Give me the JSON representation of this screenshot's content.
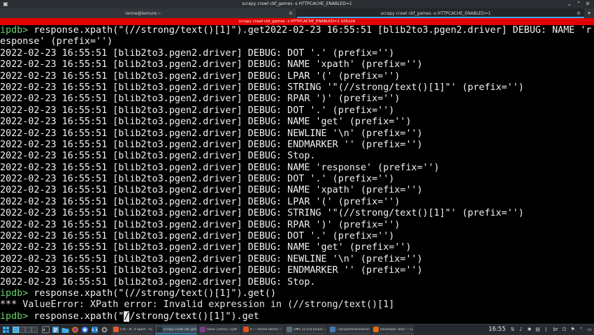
{
  "window": {
    "title": "scrapy crawl cbf_games -s HTTPCACHE_ENABLED=1",
    "status": "scrapy crawl cbf_games -s HTTPCACHE_ENABLED=1 105x26"
  },
  "tabs": [
    {
      "label": "renne@lemure:~"
    },
    {
      "label": "scrapy crawl cbf_games -s HTTPCACHE_ENABLED=1"
    }
  ],
  "terminal": {
    "prompt": "ipdb>",
    "lines": [
      "ipdb> response.xpath(\"(//strong/text()[1]\").get2022-02-23 16:55:51 [blib2to3.pgen2.driver] DEBUG: NAME 'r",
      "esponse' (prefix='')",
      "2022-02-23 16:55:51 [blib2to3.pgen2.driver] DEBUG: DOT '.' (prefix='')",
      "2022-02-23 16:55:51 [blib2to3.pgen2.driver] DEBUG: NAME 'xpath' (prefix='')",
      "2022-02-23 16:55:51 [blib2to3.pgen2.driver] DEBUG: LPAR '(' (prefix='')",
      "2022-02-23 16:55:51 [blib2to3.pgen2.driver] DEBUG: STRING '\"(//strong/text()[1]\"' (prefix='')",
      "2022-02-23 16:55:51 [blib2to3.pgen2.driver] DEBUG: RPAR ')' (prefix='')",
      "2022-02-23 16:55:51 [blib2to3.pgen2.driver] DEBUG: DOT '.' (prefix='')",
      "2022-02-23 16:55:51 [blib2to3.pgen2.driver] DEBUG: NAME 'get' (prefix='')",
      "2022-02-23 16:55:51 [blib2to3.pgen2.driver] DEBUG: NEWLINE '\\n' (prefix='')",
      "2022-02-23 16:55:51 [blib2to3.pgen2.driver] DEBUG: ENDMARKER '' (prefix='')",
      "2022-02-23 16:55:51 [blib2to3.pgen2.driver] DEBUG: Stop.",
      "2022-02-23 16:55:51 [blib2to3.pgen2.driver] DEBUG: NAME 'response' (prefix='')",
      "2022-02-23 16:55:51 [blib2to3.pgen2.driver] DEBUG: DOT '.' (prefix='')",
      "2022-02-23 16:55:51 [blib2to3.pgen2.driver] DEBUG: NAME 'xpath' (prefix='')",
      "2022-02-23 16:55:51 [blib2to3.pgen2.driver] DEBUG: LPAR '(' (prefix='')",
      "2022-02-23 16:55:51 [blib2to3.pgen2.driver] DEBUG: STRING '\"(//strong/text()[1]\"' (prefix='')",
      "2022-02-23 16:55:51 [blib2to3.pgen2.driver] DEBUG: RPAR ')' (prefix='')",
      "2022-02-23 16:55:51 [blib2to3.pgen2.driver] DEBUG: DOT '.' (prefix='')",
      "2022-02-23 16:55:51 [blib2to3.pgen2.driver] DEBUG: NAME 'get' (prefix='')",
      "2022-02-23 16:55:51 [blib2to3.pgen2.driver] DEBUG: NEWLINE '\\n' (prefix='')",
      "2022-02-23 16:55:51 [blib2to3.pgen2.driver] DEBUG: ENDMARKER '' (prefix='')",
      "2022-02-23 16:55:51 [blib2to3.pgen2.driver] DEBUG: Stop.",
      "ipdb> response.xpath(\"(//strong/text()[1]\").get()",
      "*** ValueError: XPath error: Invalid expression in (//strong/text()[1]"
    ],
    "input_before_cursor": " response.xpath(\"",
    "input_cursor_char": "/",
    "input_after_cursor": "/strong/text()[1]\").get"
  },
  "taskbar": {
    "tasks": [
      {
        "label": "Crb - Al. X Sport - FE - SE...",
        "color": "#e55b2b"
      },
      {
        "label": "scrapy crawl cbf_games -...",
        "color": "#2d2d2d"
      },
      {
        "label": "Slack | kurso | Zyte",
        "color": "#7a3f88"
      },
      {
        "label": "6 — Renne Rocha — Mo...",
        "color": "#e0531f"
      },
      {
        "label": "OMS 25.0.8 (linux) - Profil...",
        "color": "#5b6d7a"
      },
      {
        "label": "~/projects/renne/scha/s...",
        "color": "#4a78b5"
      },
      {
        "label": "Developer Tools — Crb...",
        "color": "#e06a18"
      }
    ],
    "clock": "16:55",
    "keyboard_layout": "br"
  },
  "colors": {
    "prompt": "#67d46a",
    "status_bar": "#e30000",
    "active_tab_accent": "#3daee9"
  }
}
